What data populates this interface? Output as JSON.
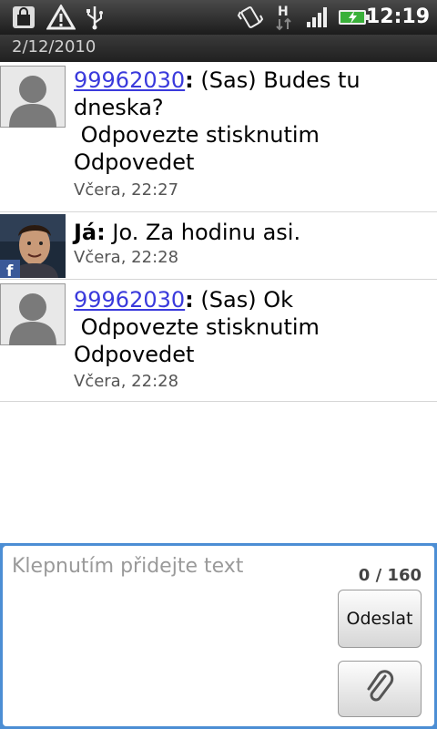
{
  "status_bar": {
    "time": "12:19",
    "icons": [
      "shopping-bag-icon",
      "warning-icon",
      "usb-icon",
      "vibrate-icon",
      "hspa-icon",
      "signal-icon",
      "battery-charging-icon"
    ],
    "network_type": "H"
  },
  "thread": {
    "date": "2/12/2010",
    "messages": [
      {
        "sender": "99962030",
        "sender_is_link": true,
        "text": " (Sas) Budes tu dneska?\n Odpovezte stisknutim Odpovedet",
        "time": "Včera, 22:27",
        "avatar": "default-contact-avatar"
      },
      {
        "sender": "Já",
        "sender_is_link": false,
        "text": " Jo. Za hodinu asi.",
        "time": "Včera, 22:28",
        "avatar": "facebook-photo-avatar"
      },
      {
        "sender": "99962030",
        "sender_is_link": true,
        "text": " (Sas) Ok\n Odpovezte stisknutim Odpovedet",
        "time": "Včera, 22:28",
        "avatar": "default-contact-avatar"
      }
    ],
    "sender_colon": ":"
  },
  "composer": {
    "placeholder": "Klepnutím přidejte text",
    "value": "",
    "counter": "0 / 160",
    "send_label": "Odeslat",
    "attach_icon": "paperclip-icon",
    "accent_color": "#4c8ed4"
  }
}
